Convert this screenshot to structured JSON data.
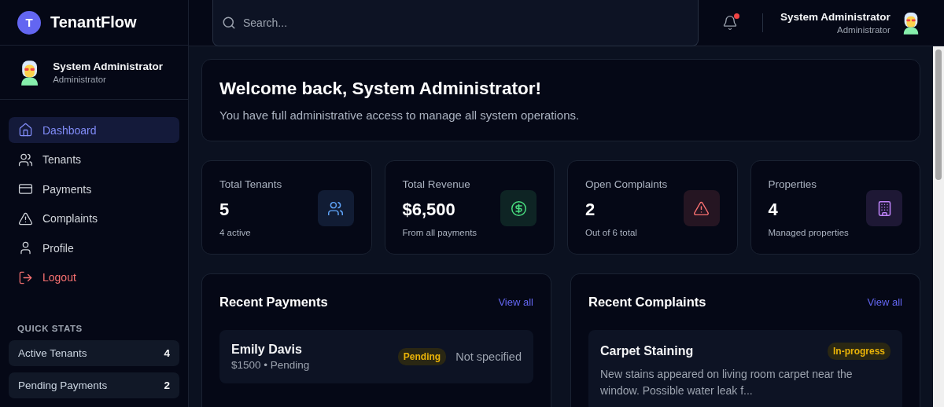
{
  "brand": {
    "initial": "T",
    "name": "TenantFlow"
  },
  "user": {
    "name": "System Administrator",
    "role": "Administrator"
  },
  "nav": [
    {
      "label": "Dashboard",
      "selected": true,
      "kind": "link"
    },
    {
      "label": "Tenants",
      "selected": false,
      "kind": "link"
    },
    {
      "label": "Payments",
      "selected": false,
      "kind": "link"
    },
    {
      "label": "Complaints",
      "selected": false,
      "kind": "link"
    },
    {
      "label": "Profile",
      "selected": false,
      "kind": "link"
    },
    {
      "label": "Logout",
      "selected": false,
      "kind": "logout"
    }
  ],
  "quick_stats": {
    "title": "QUICK STATS",
    "items": [
      {
        "label": "Active Tenants",
        "value": "4"
      },
      {
        "label": "Pending Payments",
        "value": "2"
      }
    ]
  },
  "header": {
    "search": {
      "placeholder": "Search..."
    },
    "notifications": {
      "unread": true
    },
    "user": {
      "name": "System Administrator",
      "role": "Administrator"
    }
  },
  "welcome": {
    "title": "Welcome back, System Administrator!",
    "text": "You have full administrative access to manage all system operations."
  },
  "stats": [
    {
      "label": "Total Tenants",
      "value": "5",
      "note": "4 active",
      "color": "#60a5fa"
    },
    {
      "label": "Total Revenue",
      "value": "$6,500",
      "note": "From all payments",
      "color": "#4ade80"
    },
    {
      "label": "Open Complaints",
      "value": "2",
      "note": "Out of 6 total",
      "color": "#f87171"
    },
    {
      "label": "Properties",
      "value": "4",
      "note": "Managed properties",
      "color": "#c084fc"
    }
  ],
  "recent_payments": {
    "title": "Recent Payments",
    "link": "View all",
    "items": [
      {
        "name": "Emily Davis",
        "detail": "$1500 • Pending",
        "status": "Pending",
        "method": "Not specified"
      }
    ]
  },
  "recent_complaints": {
    "title": "Recent Complaints",
    "link": "View all",
    "items": [
      {
        "title": "Carpet Staining",
        "status": "In-progress",
        "text": "New stains appeared on living room carpet near the window. Possible water leak f..."
      }
    ]
  }
}
